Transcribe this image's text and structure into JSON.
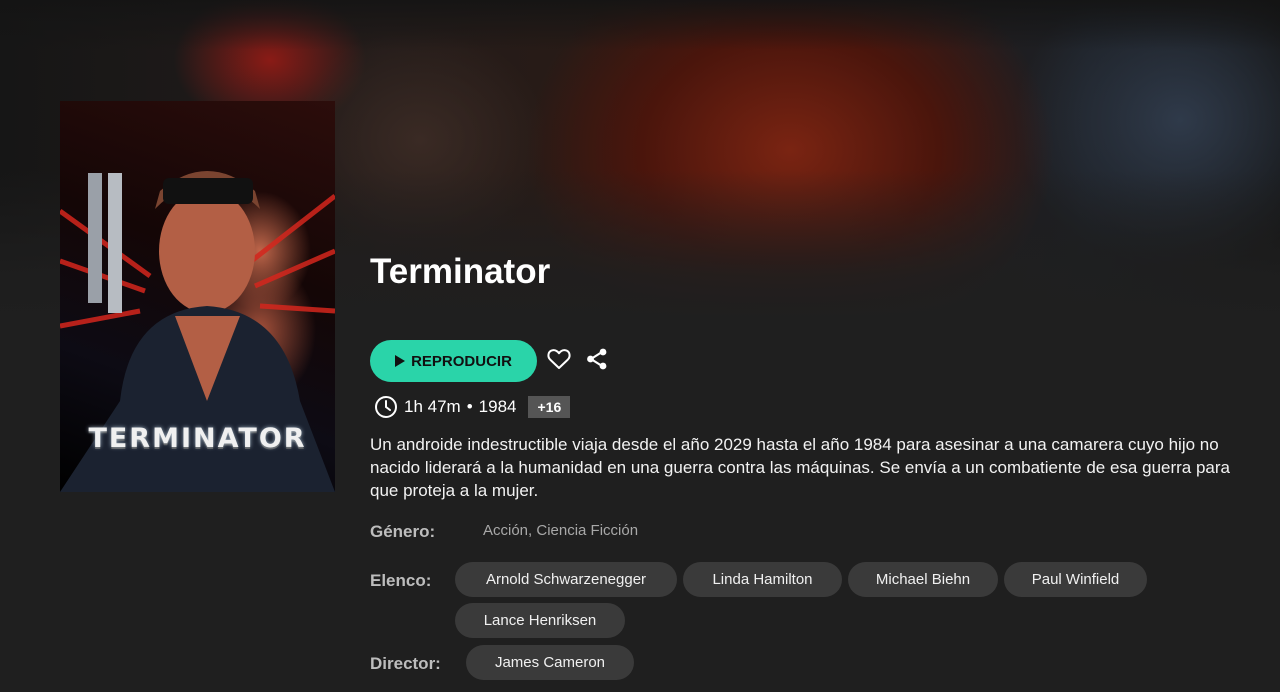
{
  "movie": {
    "title": "Terminator",
    "poster_text": "TERMINATOR",
    "play_label": "REPRODUCIR",
    "duration": "1h 47m",
    "separator": "•",
    "year": "1984",
    "rating": "+16",
    "synopsis": "Un androide indestructible viaja desde el año 2029 hasta el año 1984 para asesinar a una camarera cuyo hijo no nacido liderará a la humanidad en una guerra contra las máquinas. Se envía a un combatiente de esa guerra para que proteja a la mujer."
  },
  "details": {
    "genre_label": "Género:",
    "genre_value": "Acción, Ciencia Ficción",
    "cast_label": "Elenco:",
    "cast": [
      "Arnold Schwarzenegger",
      "Linda Hamilton",
      "Michael Biehn",
      "Paul Winfield",
      "Lance Henriksen"
    ],
    "director_label": "Director:",
    "directors": [
      "James Cameron"
    ]
  },
  "icons": {
    "play": "play-icon",
    "favorite": "heart-icon",
    "share": "share-icon",
    "duration": "clock-icon"
  },
  "colors": {
    "accent": "#2ad4a9",
    "background": "#1f1f1f",
    "chip": "#3a3a3a",
    "rating_badge": "#555555"
  }
}
